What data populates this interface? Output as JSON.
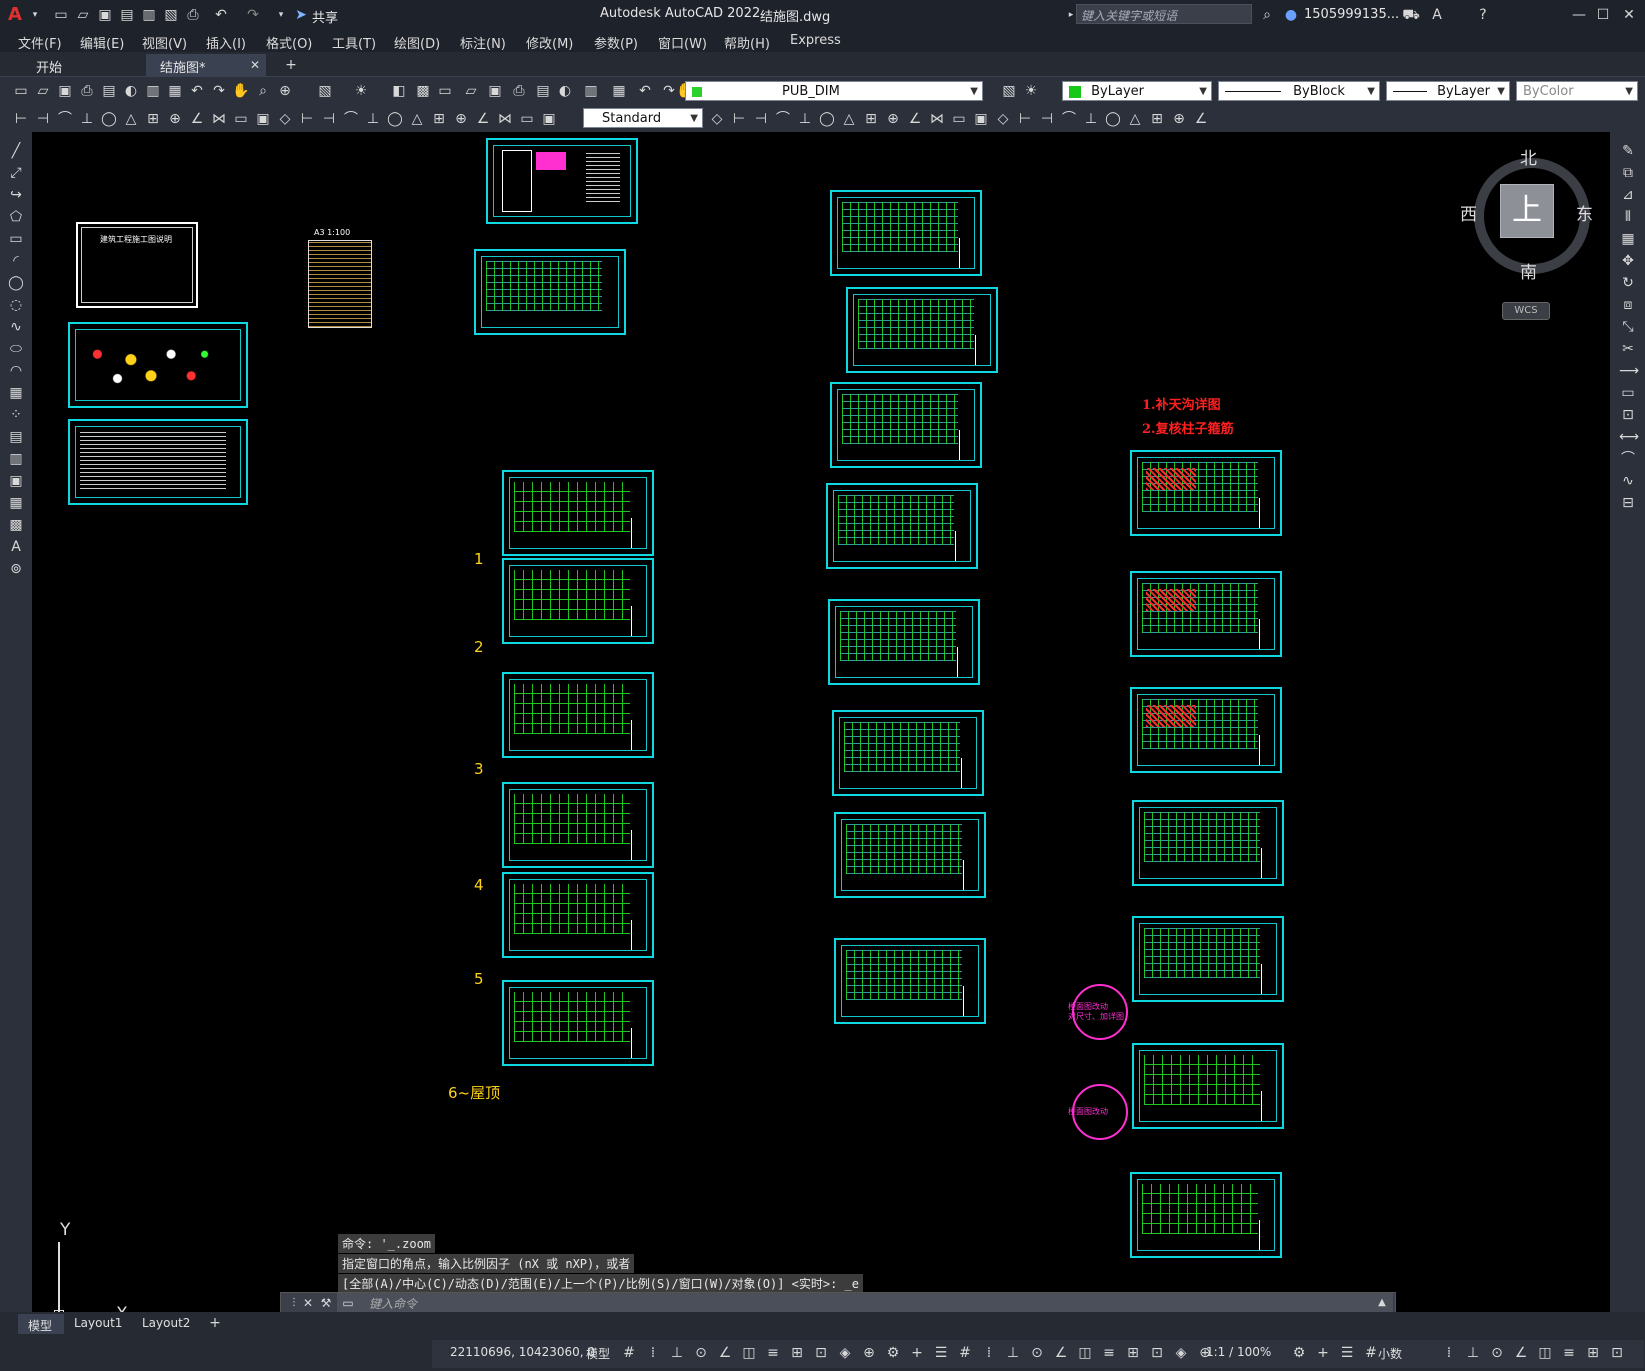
{
  "app": {
    "logo": "A",
    "title": "Autodesk AutoCAD 2022",
    "file": "结施图.dwg",
    "share_label": "共享",
    "search_placeholder": "键入关键字或短语",
    "user": "1505999135...",
    "window_controls": [
      "minimize-icon",
      "maximize-icon",
      "close-icon"
    ]
  },
  "menu": [
    "文件(F)",
    "编辑(E)",
    "视图(V)",
    "插入(I)",
    "格式(O)",
    "工具(T)",
    "绘图(D)",
    "标注(N)",
    "修改(M)",
    "参数(P)",
    "窗口(W)",
    "帮助(H)",
    "Express"
  ],
  "doc_tabs": [
    {
      "label": "开始",
      "active": false
    },
    {
      "label": "结施图*",
      "active": true
    }
  ],
  "toolbar": {
    "layer_name": "PUB_DIM",
    "color": "ByLayer",
    "linetype": "ByBlock",
    "lineweight": "ByLayer",
    "plotstyle": "ByColor",
    "dimstyle": "Standard"
  },
  "viewcube": {
    "north": "北",
    "south": "南",
    "east": "东",
    "west": "西",
    "face": "上",
    "wcs": "WCS"
  },
  "drawing": {
    "cover_title": "建筑工程施工图说明",
    "a3_label": "A3  1:100",
    "floor_labels": [
      "1",
      "2",
      "3",
      "4",
      "5",
      "6~屋顶"
    ],
    "notes": [
      "1.补天沟详图",
      "2.复核柱子箍筋"
    ],
    "bubble_notes": [
      "楼面图改动\n对尺寸、加详图",
      "楼面图改动"
    ],
    "ucs": {
      "x": "X",
      "y": "Y"
    }
  },
  "command": {
    "history": [
      "命令: '_.zoom",
      "指定窗口的角点，输入比例因子 (nX 或 nXP)，或者",
      "[全部(A)/中心(C)/动态(D)/范围(E)/上一个(P)/比例(S)/窗口(W)/对象(O)] <实时>: _e"
    ],
    "placeholder": "键入命令"
  },
  "layout_tabs": [
    "模型",
    "Layout1",
    "Layout2"
  ],
  "status": {
    "coords": "22110696, 10423060, 0",
    "mode": "模型",
    "scale": "1:1 / 100%",
    "units": "小数"
  }
}
